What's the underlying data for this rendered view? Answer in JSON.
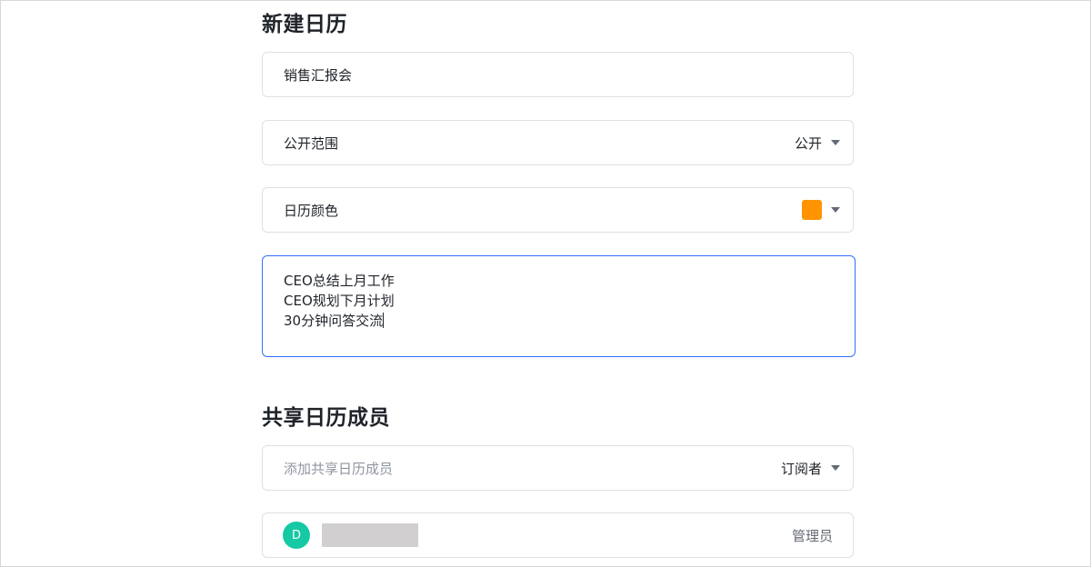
{
  "new_calendar": {
    "title": "新建日历",
    "name_value": "销售汇报会",
    "visibility": {
      "label": "公开范围",
      "value": "公开"
    },
    "color": {
      "label": "日历颜色",
      "value": "#ff9400"
    },
    "description": [
      "CEO总结上月工作",
      "CEO规划下月计划",
      "30分钟问答交流"
    ]
  },
  "sharing": {
    "title": "共享日历成员",
    "add_placeholder": "添加共享日历成员",
    "default_role": "订阅者",
    "members": [
      {
        "avatar_initial": "D",
        "role": "管理员"
      }
    ]
  },
  "icons": {
    "dropdown": "caret-down-icon",
    "avatar": "user-avatar"
  }
}
